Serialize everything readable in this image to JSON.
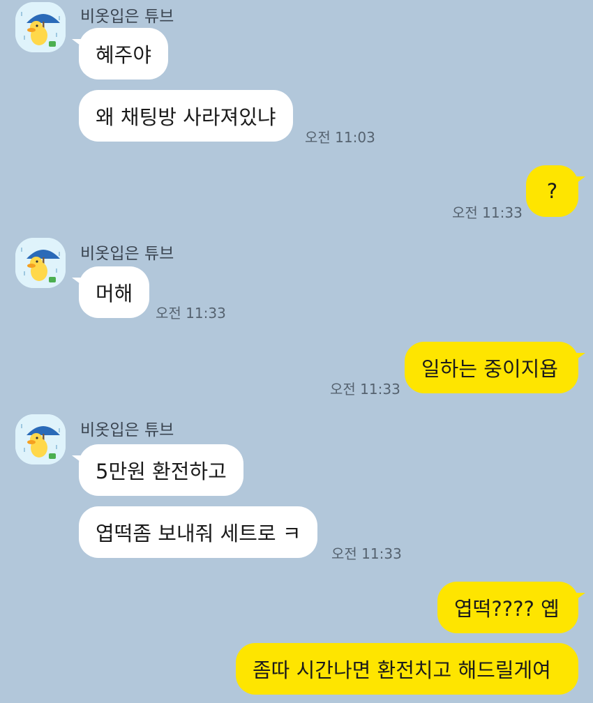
{
  "colors": {
    "background": "#b2c7da",
    "incoming_bubble": "#ffffff",
    "outgoing_bubble": "#fee500",
    "avatar_bg": "#dff3fb",
    "umbrella": "#2a6ab8"
  },
  "sender_name": "비옷입은 튜브",
  "messages": {
    "m1": "혜주야",
    "m2": "왜 채팅방 사라져있냐",
    "t1": "오전 11:03",
    "m3": "?",
    "t2": "오전 11:33",
    "m4": "머해",
    "t3": "오전 11:33",
    "m5": "일하는 중이지욥",
    "t4": "오전 11:33",
    "m6": "5만원 환전하고",
    "m7": "엽떡좀 보내줘 세트로 ㅋ",
    "t5": "오전 11:33",
    "m8": "엽떡???? 옙",
    "m9": "좀따 시간나면 환전치고 해드릴게여"
  },
  "avatar_icon": "duck-with-umbrella-icon"
}
